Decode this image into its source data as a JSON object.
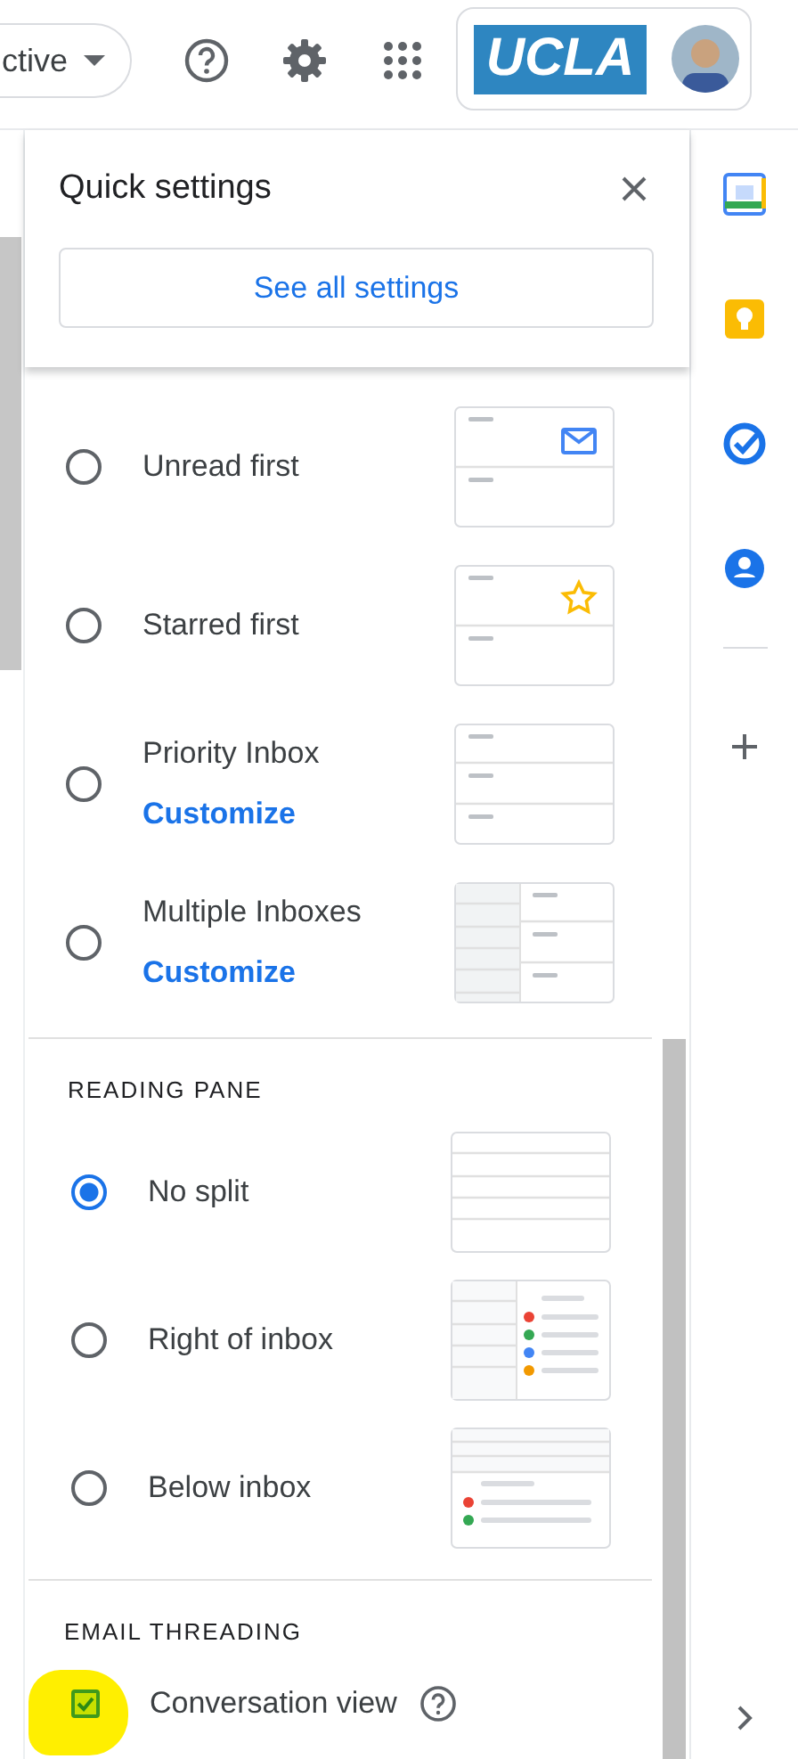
{
  "top_bar": {
    "filter_dropdown": {
      "label": "ctive"
    },
    "account_logo": "UCLA"
  },
  "quick_settings": {
    "title": "Quick settings",
    "see_all_button": "See all settings",
    "inbox_types": [
      {
        "label": "Unread first",
        "selected": false,
        "kind": "unread"
      },
      {
        "label": "Starred first",
        "selected": false,
        "kind": "starred"
      },
      {
        "label": "Priority Inbox",
        "selected": false,
        "kind": "priority",
        "link": "Customize"
      },
      {
        "label": "Multiple Inboxes",
        "selected": false,
        "kind": "multiple",
        "link": "Customize"
      }
    ],
    "reading_pane": {
      "heading": "READING PANE",
      "options": [
        {
          "label": "No split",
          "selected": true,
          "kind": "nosplit"
        },
        {
          "label": "Right of inbox",
          "selected": false,
          "kind": "right"
        },
        {
          "label": "Below inbox",
          "selected": false,
          "kind": "below"
        }
      ]
    },
    "email_threading": {
      "heading": "EMAIL THREADING",
      "options": [
        {
          "label": "Conversation view",
          "checked": true
        }
      ]
    }
  }
}
